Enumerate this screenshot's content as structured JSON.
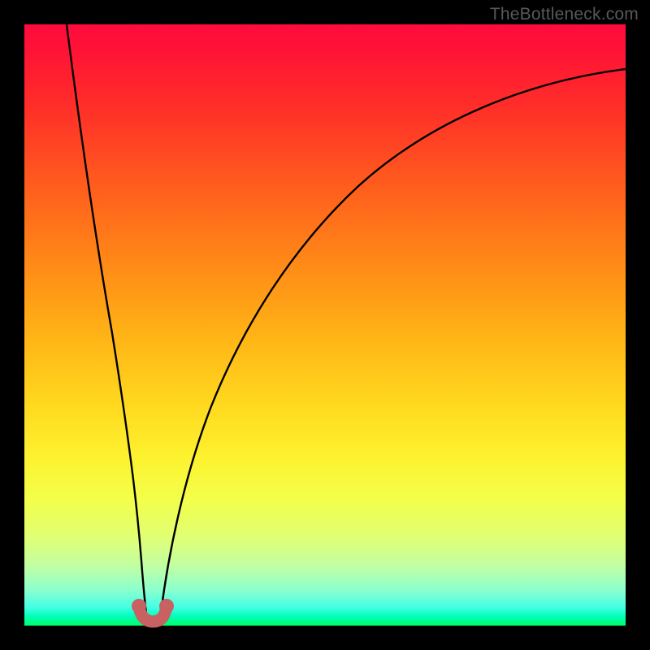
{
  "watermark": "TheBottleneck.com",
  "chart_data": {
    "type": "line",
    "title": "",
    "xlabel": "",
    "ylabel": "",
    "xlim": [
      0,
      100
    ],
    "ylim": [
      0,
      100
    ],
    "grid": false,
    "legend": false,
    "series": [
      {
        "name": "left-branch",
        "x": [
          7,
          9,
          11,
          13,
          15,
          17,
          18.5,
          19.3
        ],
        "y": [
          100,
          82,
          64,
          46,
          29,
          14,
          5,
          2
        ]
      },
      {
        "name": "right-branch",
        "x": [
          22.7,
          24,
          26,
          29,
          33,
          38,
          44,
          51,
          59,
          68,
          78,
          89,
          100
        ],
        "y": [
          2,
          6,
          14,
          25,
          36,
          47,
          57,
          66,
          74,
          80,
          85,
          89,
          92
        ]
      }
    ],
    "annotations": [
      {
        "name": "u-marker",
        "x_center": 21,
        "y": 1.5,
        "shape": "U"
      }
    ],
    "background_gradient": {
      "top": "#ff0b3e",
      "mid_upper": "#ffb416",
      "mid_lower": "#f3ff4a",
      "bottom": "#00ff66"
    }
  }
}
